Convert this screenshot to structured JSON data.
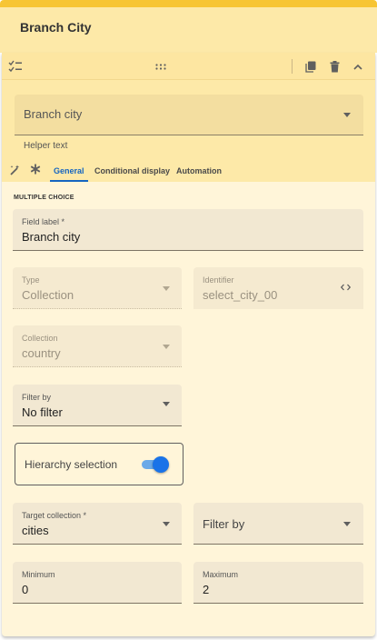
{
  "header": {
    "title": "Branch City"
  },
  "toolbar": {
    "icons": [
      "checklist-icon",
      "drag-handle-icon",
      "copy-icon",
      "delete-icon",
      "chevron-up-icon"
    ]
  },
  "field_type_select": {
    "value": "Branch city",
    "helper_text": "Helper text"
  },
  "tabs": [
    {
      "label": "General",
      "active": true
    },
    {
      "label": "Conditional display",
      "active": false
    },
    {
      "label": "Automation",
      "active": false
    }
  ],
  "section_title": "MULTIPLE CHOICE",
  "form": {
    "field_label": {
      "label": "Field label *",
      "value": "Branch city"
    },
    "type": {
      "label": "Type",
      "value": "Collection"
    },
    "identifier": {
      "label": "Identifier",
      "value": "select_city_00"
    },
    "collection": {
      "label": "Collection",
      "value": "country"
    },
    "filter_by": {
      "label": "Filter by",
      "value": "No filter"
    },
    "hierarchy_selection": {
      "label": "Hierarchy selection",
      "enabled": true
    },
    "target_collection": {
      "label": "Target collection *",
      "value": "cities"
    },
    "target_filter": {
      "placeholder": "Filter by"
    },
    "minimum": {
      "label": "Minimum",
      "value": "0"
    },
    "maximum": {
      "label": "Maximum",
      "value": "2"
    }
  },
  "colors": {
    "accent": "#1a73e8",
    "header_bar": "#f7c534",
    "panel_bg": "#fff5d9",
    "header_bg": "#fde9a8"
  }
}
